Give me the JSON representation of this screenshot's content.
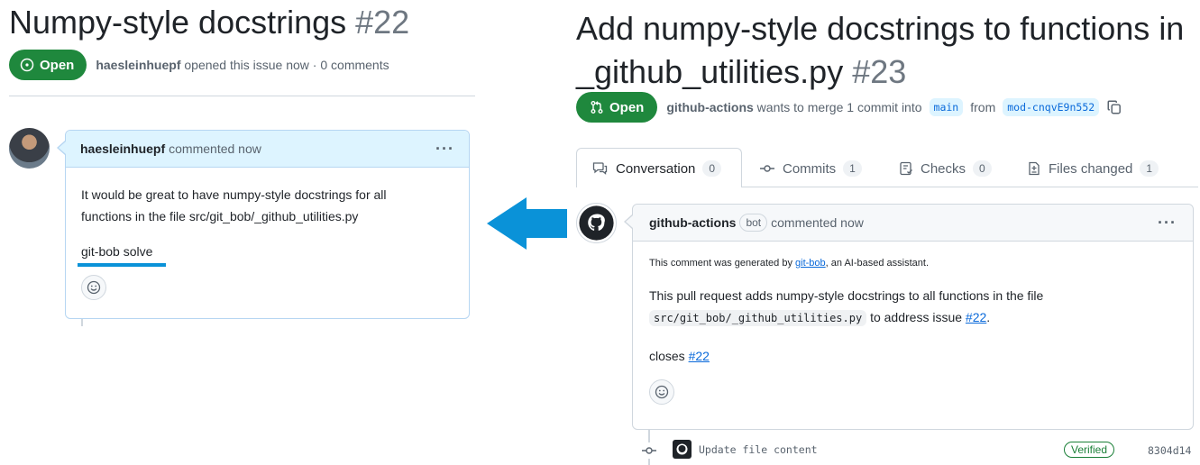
{
  "issue": {
    "title": "Numpy-style docstrings",
    "number": "#22",
    "state": "Open",
    "author": "haesleinhuepf",
    "meta_text": "opened this issue now · 0 comments",
    "comment": {
      "author": "haesleinhuepf",
      "time": "commented now",
      "body_line1": "It would be great to have numpy-style docstrings for all",
      "body_line2": "functions in the file src/git_bob/_github_utilities.py",
      "command": "git-bob solve"
    }
  },
  "pull_request": {
    "title": "Add numpy-style docstrings to functions in _github_utilities.py",
    "number": "#23",
    "state": "Open",
    "author": "github-actions",
    "merge_text": "wants to merge 1 commit into",
    "base_branch": "main",
    "from_text": "from",
    "head_branch": "mod-cnqvE9n552",
    "tabs": [
      {
        "label": "Conversation",
        "count": "0"
      },
      {
        "label": "Commits",
        "count": "1"
      },
      {
        "label": "Checks",
        "count": "0"
      },
      {
        "label": "Files changed",
        "count": "1"
      }
    ],
    "comment": {
      "author": "github-actions",
      "bot_label": "bot",
      "time": "commented now",
      "note_prefix": "This comment was generated by",
      "note_link": "git-bob",
      "note_suffix": ", an AI-based assistant.",
      "body_prefix": "This pull request adds numpy-style docstrings to all functions in the file",
      "body_code": "src/git_bob/_github_utilities.py",
      "body_mid": "to address issue",
      "body_issue_link": "#22",
      "body_end": ".",
      "closes_text": "closes",
      "closes_link": "#22"
    },
    "commit": {
      "message": "Update file content",
      "verified": "Verified",
      "sha": "8304d14"
    }
  },
  "colors": {
    "open_green": "#1f883d",
    "arrow_blue": "#0a92d8",
    "link_blue": "#0969da",
    "highlight_header": "#ddf4ff"
  }
}
